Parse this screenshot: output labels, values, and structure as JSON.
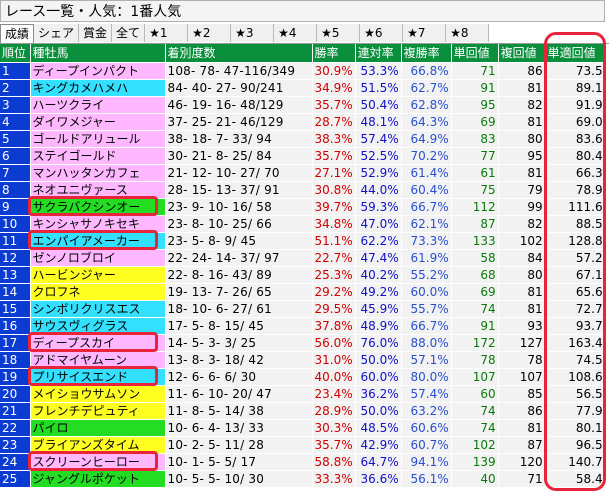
{
  "window": {
    "title": "レース一覧・人気：1番人気"
  },
  "tabs": [
    "成績",
    "シェア",
    "賞金",
    "全て",
    "★1",
    "★2",
    "★3",
    "★4",
    "★5",
    "★6",
    "★7",
    "★8"
  ],
  "columns": [
    "順位",
    "種牡馬",
    "着別度数",
    "勝率",
    "連対率",
    "複勝率",
    "単回値",
    "複回値",
    "単適回値"
  ],
  "colors": {
    "header_green": "#0a8f3c",
    "rank_blue": "#0b3bd0",
    "pink": "#ffb8ff",
    "cyan": "#33e0ff",
    "yellow": "#ffff22",
    "green": "#22dd22",
    "highlight_red": "#e8243a"
  },
  "rows": [
    {
      "rank": "1",
      "horse": "ディープインパクト",
      "stats": "108- 78- 47-116/349",
      "win": "30.9%",
      "place2": "53.3%",
      "place3": "66.8%",
      "ret_win": "71",
      "ret_place": "86",
      "ret_adj": "73.5",
      "bg": "pink",
      "highlight": false
    },
    {
      "rank": "2",
      "horse": "キングカメハメハ",
      "stats": "84- 40- 27- 90/241",
      "win": "34.9%",
      "place2": "51.5%",
      "place3": "62.7%",
      "ret_win": "91",
      "ret_place": "81",
      "ret_adj": "89.1",
      "bg": "cyan",
      "highlight": false
    },
    {
      "rank": "3",
      "horse": "ハーツクライ",
      "stats": "46- 19- 16- 48/129",
      "win": "35.7%",
      "place2": "50.4%",
      "place3": "62.8%",
      "ret_win": "95",
      "ret_place": "82",
      "ret_adj": "91.9",
      "bg": "pink",
      "highlight": false
    },
    {
      "rank": "4",
      "horse": "ダイワメジャー",
      "stats": "37- 25- 21- 46/129",
      "win": "28.7%",
      "place2": "48.1%",
      "place3": "64.3%",
      "ret_win": "69",
      "ret_place": "81",
      "ret_adj": "69.0",
      "bg": "pink",
      "highlight": false
    },
    {
      "rank": "5",
      "horse": "ゴールドアリュール",
      "stats": "38- 18- 7- 33/ 94",
      "win": "38.3%",
      "place2": "57.4%",
      "place3": "64.9%",
      "ret_win": "83",
      "ret_place": "80",
      "ret_adj": "83.6",
      "bg": "pink",
      "highlight": false
    },
    {
      "rank": "6",
      "horse": "ステイゴールド",
      "stats": "30- 21- 8- 25/ 84",
      "win": "35.7%",
      "place2": "52.5%",
      "place3": "70.2%",
      "ret_win": "77",
      "ret_place": "95",
      "ret_adj": "80.4",
      "bg": "pink",
      "highlight": false
    },
    {
      "rank": "7",
      "horse": "マンハッタンカフェ",
      "stats": "21- 12- 10- 27/ 70",
      "win": "27.1%",
      "place2": "52.9%",
      "place3": "61.4%",
      "ret_win": "61",
      "ret_place": "81",
      "ret_adj": "66.3",
      "bg": "pink",
      "highlight": false
    },
    {
      "rank": "8",
      "horse": "ネオユニヴァース",
      "stats": "28- 15- 13- 37/ 91",
      "win": "30.8%",
      "place2": "44.0%",
      "place3": "60.4%",
      "ret_win": "75",
      "ret_place": "79",
      "ret_adj": "78.9",
      "bg": "pink",
      "highlight": false
    },
    {
      "rank": "9",
      "horse": "サクラバクシンオー",
      "stats": "23- 9- 10- 16/ 58",
      "win": "39.7%",
      "place2": "59.3%",
      "place3": "66.7%",
      "ret_win": "112",
      "ret_place": "99",
      "ret_adj": "111.6",
      "bg": "green",
      "highlight": true
    },
    {
      "rank": "10",
      "horse": "キンシャサノキセキ",
      "stats": "23- 8- 10- 25/ 66",
      "win": "34.8%",
      "place2": "47.0%",
      "place3": "62.1%",
      "ret_win": "87",
      "ret_place": "82",
      "ret_adj": "88.5",
      "bg": "pink",
      "highlight": false
    },
    {
      "rank": "11",
      "horse": "エンパイアメーカー",
      "stats": "23- 5- 8- 9/ 45",
      "win": "51.1%",
      "place2": "62.2%",
      "place3": "73.3%",
      "ret_win": "133",
      "ret_place": "102",
      "ret_adj": "128.8",
      "bg": "cyan",
      "highlight": true
    },
    {
      "rank": "12",
      "horse": "ゼンノロブロイ",
      "stats": "22- 24- 14- 37/ 97",
      "win": "22.7%",
      "place2": "47.4%",
      "place3": "61.9%",
      "ret_win": "58",
      "ret_place": "84",
      "ret_adj": "57.2",
      "bg": "pink",
      "highlight": false
    },
    {
      "rank": "13",
      "horse": "ハービンジャー",
      "stats": "22- 8- 16- 43/ 89",
      "win": "25.3%",
      "place2": "40.2%",
      "place3": "55.2%",
      "ret_win": "68",
      "ret_place": "80",
      "ret_adj": "67.1",
      "bg": "yellow",
      "highlight": false
    },
    {
      "rank": "14",
      "horse": "クロフネ",
      "stats": "19- 13- 7- 26/ 65",
      "win": "29.2%",
      "place2": "49.2%",
      "place3": "60.0%",
      "ret_win": "69",
      "ret_place": "81",
      "ret_adj": "65.6",
      "bg": "yellow",
      "highlight": false
    },
    {
      "rank": "15",
      "horse": "シンボリクリスエス",
      "stats": "18- 10- 6- 27/ 61",
      "win": "29.5%",
      "place2": "45.9%",
      "place3": "55.7%",
      "ret_win": "74",
      "ret_place": "81",
      "ret_adj": "72.7",
      "bg": "cyan",
      "highlight": false
    },
    {
      "rank": "16",
      "horse": "サウスヴィグラス",
      "stats": "17- 5- 8- 15/ 45",
      "win": "37.8%",
      "place2": "48.9%",
      "place3": "66.7%",
      "ret_win": "91",
      "ret_place": "93",
      "ret_adj": "93.7",
      "bg": "cyan",
      "highlight": false
    },
    {
      "rank": "17",
      "horse": "ディープスカイ",
      "stats": "14- 5- 3- 3/ 25",
      "win": "56.0%",
      "place2": "76.0%",
      "place3": "88.0%",
      "ret_win": "172",
      "ret_place": "127",
      "ret_adj": "163.4",
      "bg": "pink",
      "highlight": true
    },
    {
      "rank": "18",
      "horse": "アドマイヤムーン",
      "stats": "13- 8- 3- 18/ 42",
      "win": "31.0%",
      "place2": "50.0%",
      "place3": "57.1%",
      "ret_win": "78",
      "ret_place": "78",
      "ret_adj": "74.5",
      "bg": "pink",
      "highlight": false
    },
    {
      "rank": "19",
      "horse": "プリサイスエンド",
      "stats": "12- 6- 6- 6/ 30",
      "win": "40.0%",
      "place2": "60.0%",
      "place3": "80.0%",
      "ret_win": "107",
      "ret_place": "107",
      "ret_adj": "108.6",
      "bg": "cyan",
      "highlight": true
    },
    {
      "rank": "20",
      "horse": "メイショウサムソン",
      "stats": "11- 6- 10- 20/ 47",
      "win": "23.4%",
      "place2": "36.2%",
      "place3": "57.4%",
      "ret_win": "60",
      "ret_place": "85",
      "ret_adj": "56.5",
      "bg": "yellow",
      "highlight": false
    },
    {
      "rank": "21",
      "horse": "フレンチデピュティ",
      "stats": "11- 8- 5- 14/ 38",
      "win": "28.9%",
      "place2": "50.0%",
      "place3": "63.2%",
      "ret_win": "74",
      "ret_place": "86",
      "ret_adj": "77.9",
      "bg": "yellow",
      "highlight": false
    },
    {
      "rank": "22",
      "horse": "パイロ",
      "stats": "10- 6- 4- 13/ 33",
      "win": "30.3%",
      "place2": "48.5%",
      "place3": "60.6%",
      "ret_win": "74",
      "ret_place": "81",
      "ret_adj": "80.1",
      "bg": "green",
      "highlight": false
    },
    {
      "rank": "23",
      "horse": "ブライアンズタイム",
      "stats": "10- 2- 5- 11/ 28",
      "win": "35.7%",
      "place2": "42.9%",
      "place3": "60.7%",
      "ret_win": "102",
      "ret_place": "87",
      "ret_adj": "96.5",
      "bg": "yellow",
      "highlight": false
    },
    {
      "rank": "24",
      "horse": "スクリーンヒーロー",
      "stats": "10- 1- 5- 5/ 17",
      "win": "58.8%",
      "place2": "64.7%",
      "place3": "94.1%",
      "ret_win": "139",
      "ret_place": "120",
      "ret_adj": "140.7",
      "bg": "pink",
      "highlight": true
    },
    {
      "rank": "25",
      "horse": "ジャングルポケット",
      "stats": "10- 5- 5- 10/ 30",
      "win": "33.3%",
      "place2": "36.6%",
      "place3": "56.1%",
      "ret_win": "40",
      "ret_place": "71",
      "ret_adj": "58.4",
      "bg": "green",
      "highlight": false
    }
  ]
}
